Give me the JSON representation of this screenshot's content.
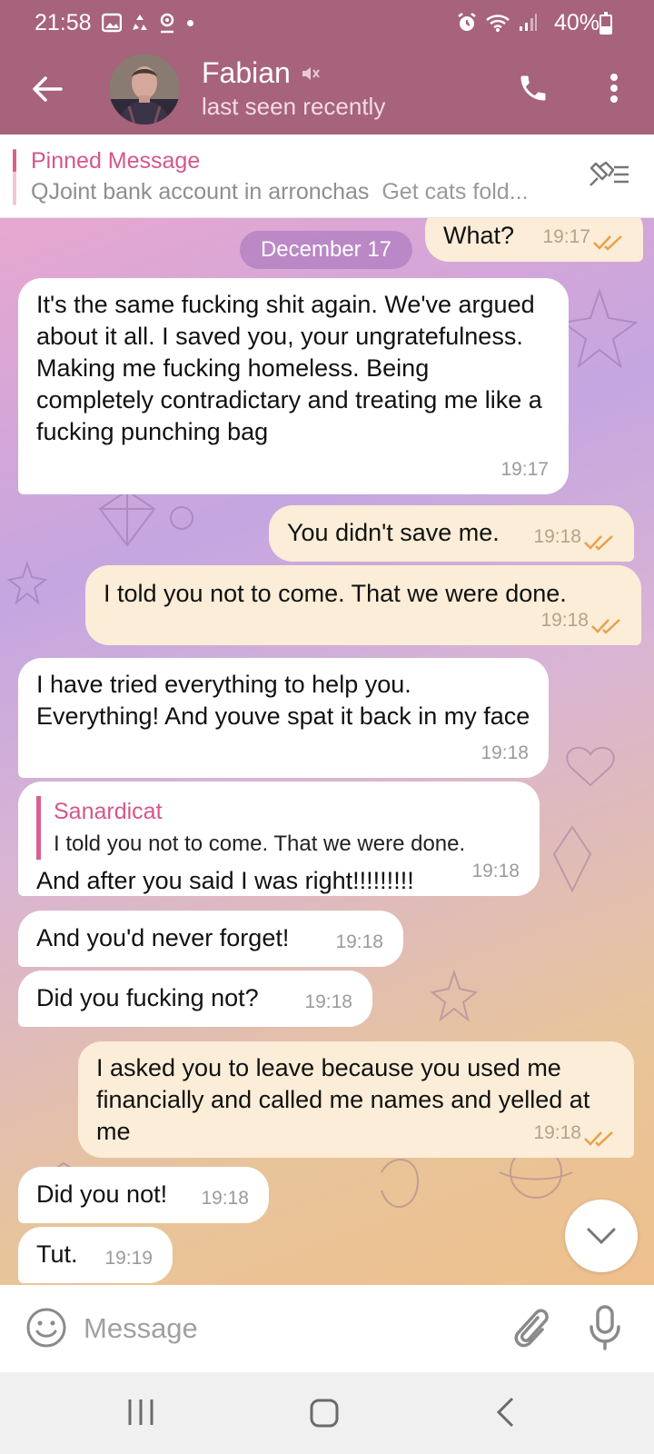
{
  "status_bar": {
    "time": "21:58",
    "battery": "40%"
  },
  "header": {
    "name": "Fabian",
    "status": "last seen recently"
  },
  "pinned": {
    "title": "Pinned Message",
    "text_part1": "QJoint bank account in arronchas",
    "text_part2": "Get cats fold..."
  },
  "chat": {
    "date_chip": "December 17",
    "messages": [
      {
        "dir": "out",
        "text": "What?",
        "time": "19:17"
      },
      {
        "dir": "in",
        "text": "It's the same fucking shit again. We've argued about it all. I saved you, your ungratefulness. Making me fucking homeless. Being completely contradictary and treating me like a fucking punching bag",
        "time": "19:17"
      },
      {
        "dir": "out",
        "text": "You didn't save me.",
        "time": "19:18"
      },
      {
        "dir": "out",
        "text": "I told you not to come. That we were done.",
        "time": "19:18"
      },
      {
        "dir": "in",
        "text": "I have tried everything to help you. Everything! And youve spat it back in my face",
        "time": "19:18"
      },
      {
        "dir": "in",
        "reply_name": "Sanardicat",
        "reply_text": "I told you not to come. That we were done.",
        "text": "And after you said I was right!!!!!!!!!",
        "time": "19:18"
      },
      {
        "dir": "in",
        "text": "And you'd never forget!",
        "time": "19:18"
      },
      {
        "dir": "in",
        "text": "Did you fucking not?",
        "time": "19:18"
      },
      {
        "dir": "out",
        "text": "I asked you to leave because you used me financially and called me names and yelled at me",
        "time": "19:18"
      },
      {
        "dir": "in",
        "text": "Did you not!",
        "time": "19:18"
      },
      {
        "dir": "in",
        "text": "Tut.",
        "time": "19:19"
      }
    ]
  },
  "input": {
    "placeholder": "Message"
  },
  "colors": {
    "header": "#a7627c",
    "accent": "#d4578a",
    "outgoing_bubble": "#fbedd7",
    "incoming_bubble": "#ffffff",
    "read_ticks": "#e8a04b"
  },
  "icons": [
    "back-arrow-icon",
    "mute-icon",
    "phone-icon",
    "more-vert-icon",
    "pin-list-icon",
    "read-ticks-icon",
    "chevron-down-icon",
    "emoji-icon",
    "attach-icon",
    "mic-icon"
  ]
}
